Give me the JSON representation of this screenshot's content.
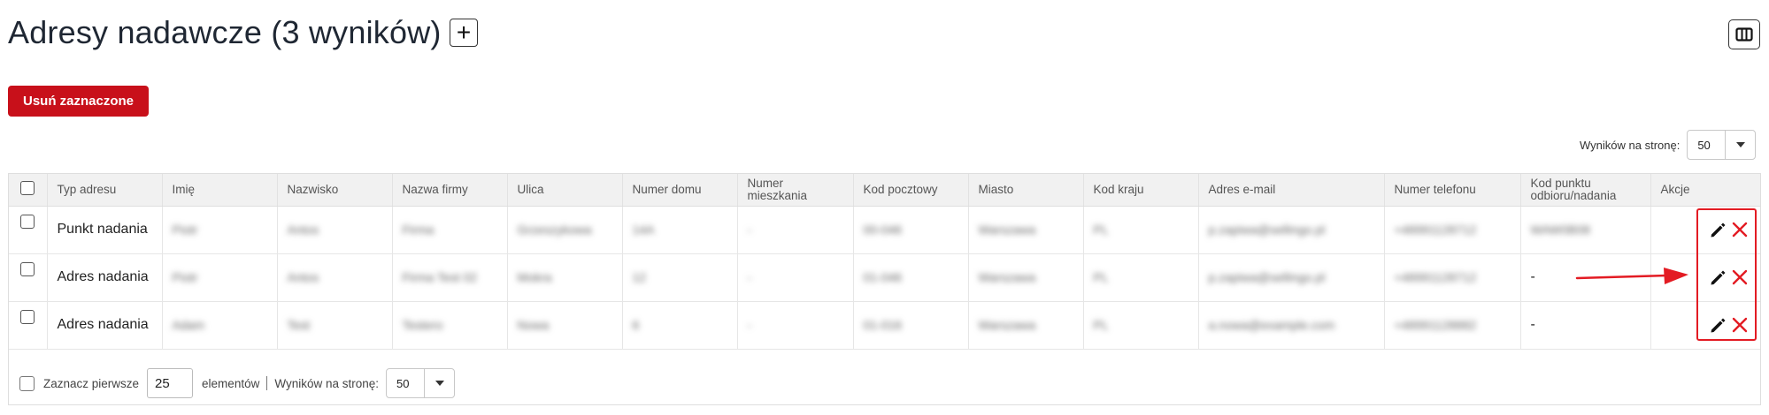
{
  "page": {
    "title": "Adresy nadawcze (3 wyników)",
    "add_label": "+",
    "delete_selected_label": "Usuń zaznaczone",
    "per_page_label": "Wyników na stronę:",
    "per_page_value": "50"
  },
  "table": {
    "columns": [
      "Typ adresu",
      "Imię",
      "Nazwisko",
      "Nazwa firmy",
      "Ulica",
      "Numer domu",
      "Numer mieszkania",
      "Kod pocztowy",
      "Miasto",
      "Kod kraju",
      "Adres e-mail",
      "Numer telefonu",
      "Kod punktu odbioru/nadania",
      "Akcje"
    ],
    "rows": [
      {
        "type": "Punkt nadania",
        "first": "Piotr",
        "last": "Antos",
        "company": "Firma",
        "street": "Grzeszykowa",
        "house": "14A",
        "apt": "-",
        "zip": "00-046",
        "city": "Warszawa",
        "country": "PL",
        "email": "p.zapiwa@sellingo.pl",
        "phone": "+48991128712",
        "point": "WAW0B08"
      },
      {
        "type": "Adres nadania",
        "first": "Piotr",
        "last": "Antos",
        "company": "Firma Test 02",
        "street": "Mokra",
        "house": "12",
        "apt": "-",
        "zip": "01-046",
        "city": "Warszawa",
        "country": "PL",
        "email": "p.zapiwa@sellingo.pl",
        "phone": "+48991128712",
        "point": "-"
      },
      {
        "type": "Adres nadania",
        "first": "Adam",
        "last": "Test",
        "company": "Testero",
        "street": "Nowa",
        "house": "6",
        "apt": "-",
        "zip": "01-016",
        "city": "Warszawa",
        "country": "PL",
        "email": "a.nowa@example.com",
        "phone": "+48991128882",
        "point": "-"
      }
    ]
  },
  "footer": {
    "select_first_label": "Zaznacz pierwsze",
    "select_first_value": "25",
    "elements_label": "elementów",
    "per_page_label": "Wyników na stronę:",
    "per_page_value": "50"
  },
  "icons": {
    "columns": "columns-icon",
    "edit": "pencil-icon",
    "delete": "close-icon",
    "arrow": "arrow-right-icon"
  },
  "colors": {
    "accent_red": "#c8101a",
    "highlight_red": "#e31b23"
  }
}
